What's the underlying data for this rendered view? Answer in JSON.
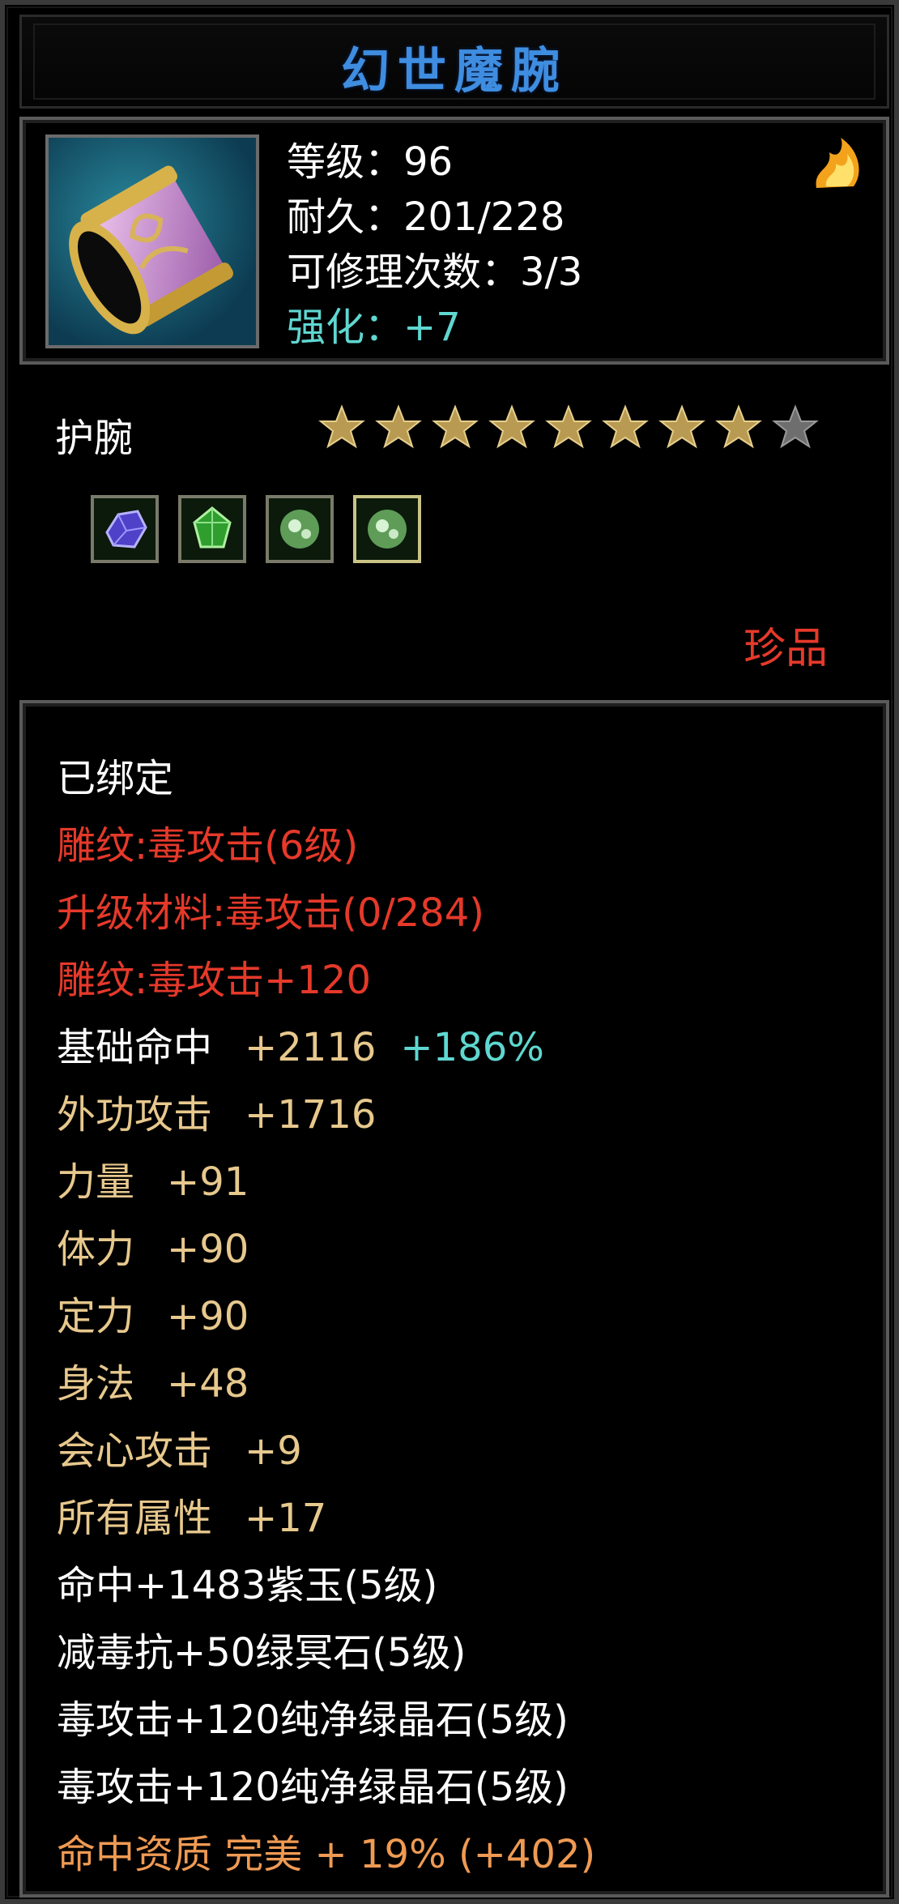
{
  "title": "幻世魔腕",
  "item": {
    "icon": "bracer-icon",
    "level": "等级：96",
    "durability": "耐久：201/228",
    "repairs": "可修理次数：3/3",
    "enhance": "强化：+7",
    "badge_icon": "fire-icon"
  },
  "slot": "护腕",
  "stars": {
    "filled": 8,
    "total": 9
  },
  "gems": [
    {
      "icon": "purple-gem-icon",
      "color": "#5a4cd0"
    },
    {
      "icon": "green-gem-icon",
      "color": "#3fae3a"
    },
    {
      "icon": "pale-green-gem-icon",
      "color": "#8fc98a"
    },
    {
      "icon": "pale-green-gem-icon",
      "color": "#8fc98a"
    }
  ],
  "rarity": "珍品",
  "bound": "已绑定",
  "engrave": {
    "name": "雕纹:毒攻击(6级)",
    "material": "升级材料:毒攻击(0/284)",
    "bonus": "雕纹:毒攻击+120"
  },
  "attributes": [
    {
      "name": "基础命中",
      "value": "+2116",
      "extra": "+186%"
    },
    {
      "name": "外功攻击",
      "value": "+1716"
    },
    {
      "name": "力量",
      "value": "+91"
    },
    {
      "name": "体力",
      "value": "+90"
    },
    {
      "name": "定力",
      "value": "+90"
    },
    {
      "name": "身法",
      "value": "+48"
    },
    {
      "name": "会心攻击",
      "value": "+9"
    },
    {
      "name": "所有属性",
      "value": "+17"
    }
  ],
  "gem_lines": [
    "命中+1483紫玉(5级)",
    "减毒抗+50绿冥石(5级)",
    "毒攻击+120纯净绿晶石(5级)",
    "毒攻击+120纯净绿晶石(5级)"
  ],
  "quality": "命中资质 完美 + 19% (+402)",
  "colors": {
    "title": "#3f8de0",
    "engrave": "#e5392a",
    "attribute": "#e7c88d",
    "percent": "#5fd7d0",
    "quality": "#ef9a53"
  }
}
